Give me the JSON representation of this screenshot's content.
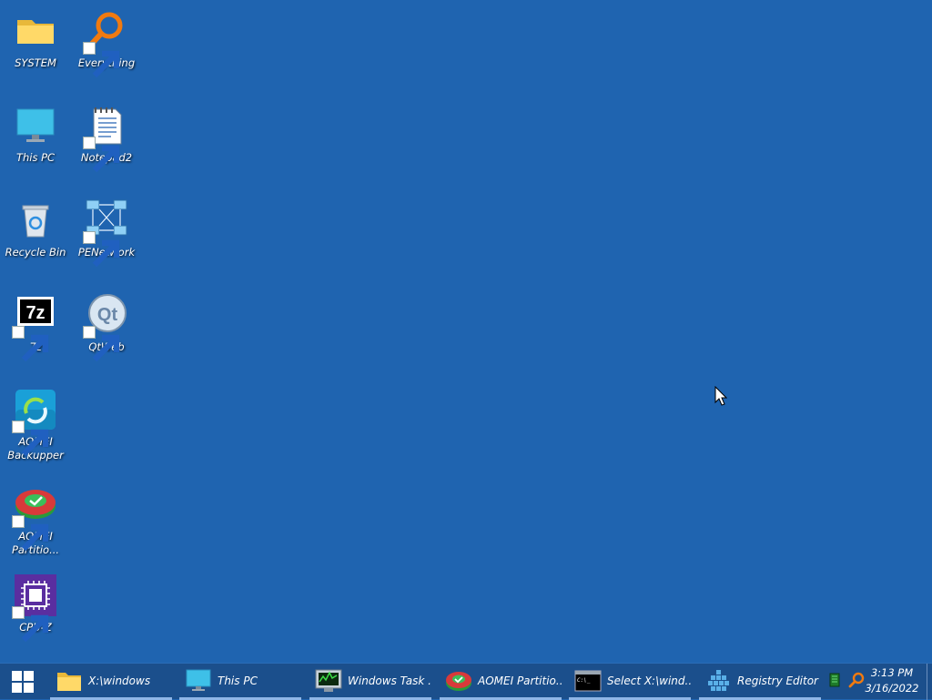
{
  "desktop": {
    "icons": [
      {
        "label": "SYSTEM",
        "icon": "folder-icon"
      },
      {
        "label": "Everything",
        "icon": "magnifier-icon"
      },
      {
        "label": "This PC",
        "icon": "monitor-icon"
      },
      {
        "label": "Notepad2",
        "icon": "notepad-icon"
      },
      {
        "label": "Recycle Bin",
        "icon": "recycle-bin-icon"
      },
      {
        "label": "PENetwork",
        "icon": "network-icon"
      },
      {
        "label": "7z",
        "icon": "7z-icon"
      },
      {
        "label": "QtWeb",
        "icon": "qt-icon"
      },
      {
        "label": "AOMEI Backupper",
        "icon": "aomei-backupper-icon"
      },
      {
        "label": "AOMEI Partitio...",
        "icon": "aomei-partition-icon"
      },
      {
        "label": "CPU-Z",
        "icon": "cpu-z-icon"
      }
    ]
  },
  "taskbar": {
    "items": [
      {
        "label": "X:\\windows",
        "icon": "folder-icon"
      },
      {
        "label": "This PC",
        "icon": "monitor-icon"
      },
      {
        "label": "Windows Task ...",
        "icon": "task-manager-icon"
      },
      {
        "label": "AOMEI Partitio...",
        "icon": "aomei-partition-icon"
      },
      {
        "label": "Select X:\\wind...",
        "icon": "cmd-icon"
      },
      {
        "label": "Registry Editor",
        "icon": "registry-icon"
      }
    ],
    "clock": {
      "time": "3:13 PM",
      "date": "3/16/2022"
    }
  },
  "colors": {
    "desktop_bg": "#1f64b0",
    "taskbar_bg": "#1b4f8c"
  }
}
